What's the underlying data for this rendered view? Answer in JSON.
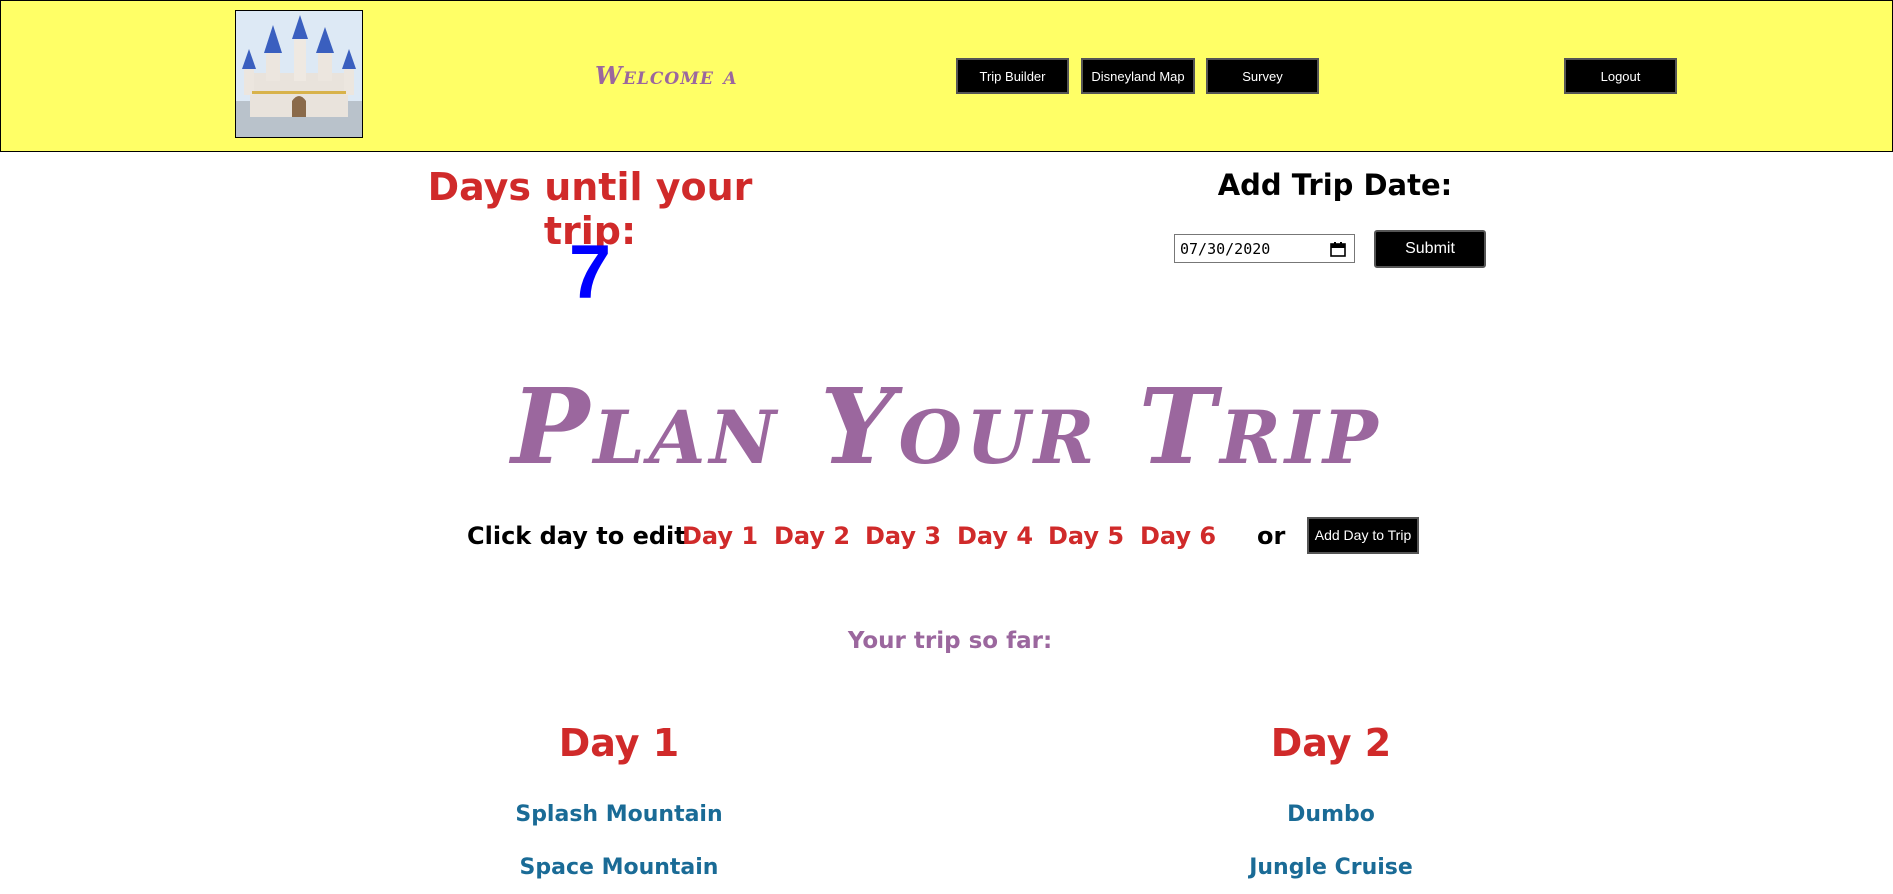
{
  "header": {
    "welcome": "Welcome a",
    "nav": {
      "trip_builder": "Trip Builder",
      "disneyland_map": "Disneyland Map",
      "survey": "Survey",
      "logout": "Logout"
    }
  },
  "countdown": {
    "title": "Days until your trip:",
    "days": "7"
  },
  "trip_date": {
    "title": "Add Trip Date:",
    "value": "07/30/2020",
    "submit_label": "Submit"
  },
  "plan": {
    "title": "Plan Your Trip",
    "click_label": "Click day to edit",
    "days": [
      "Day 1",
      "Day 2",
      "Day 3",
      "Day 4",
      "Day 5",
      "Day 6"
    ],
    "or_label": "or",
    "add_day_label": "Add Day to Trip"
  },
  "trip_so_far": {
    "label": "Your trip so far:",
    "days": [
      {
        "title": "Day 1",
        "attractions": [
          "Splash Mountain",
          "Space Mountain"
        ]
      },
      {
        "title": "Day 2",
        "attractions": [
          "Dumbo",
          "Jungle Cruise"
        ]
      }
    ]
  },
  "colors": {
    "header_bg": "#ffff66",
    "accent_purple": "#9b679e",
    "day_red": "#d02a2a",
    "countdown_blue": "#0000ff",
    "attraction_blue": "#1a6b96"
  }
}
